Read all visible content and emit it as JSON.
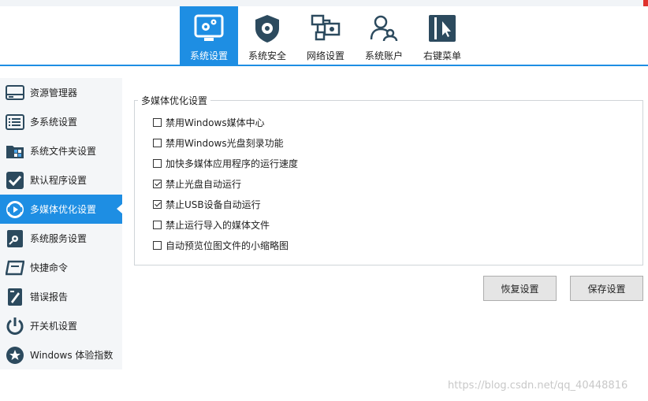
{
  "toolbar": {
    "tabs": [
      {
        "label": "系统设置",
        "icon": "gear-screen-icon",
        "active": true
      },
      {
        "label": "系统安全",
        "icon": "shield-gear-icon",
        "active": false
      },
      {
        "label": "网络设置",
        "icon": "network-icon",
        "active": false
      },
      {
        "label": "系统账户",
        "icon": "users-icon",
        "active": false
      },
      {
        "label": "右键菜单",
        "icon": "context-menu-icon",
        "active": false
      }
    ]
  },
  "sidebar": {
    "items": [
      {
        "label": "资源管理器",
        "icon": "explorer-icon"
      },
      {
        "label": "多系统设置",
        "icon": "multi-system-icon"
      },
      {
        "label": "系统文件夹设置",
        "icon": "windows-folder-icon"
      },
      {
        "label": "默认程序设置",
        "icon": "default-program-icon"
      },
      {
        "label": "多媒体优化设置",
        "icon": "multimedia-icon",
        "active": true
      },
      {
        "label": "系统服务设置",
        "icon": "service-icon"
      },
      {
        "label": "快捷命令",
        "icon": "command-icon"
      },
      {
        "label": "错误报告",
        "icon": "error-report-icon"
      },
      {
        "label": "开关机设置",
        "icon": "power-icon"
      },
      {
        "label": "Windows 体验指数",
        "icon": "star-icon"
      }
    ]
  },
  "main": {
    "group_title": "多媒体优化设置",
    "options": [
      {
        "label": "禁用Windows媒体中心",
        "checked": false
      },
      {
        "label": "禁用Windows光盘刻录功能",
        "checked": false
      },
      {
        "label": "加快多媒体应用程序的运行速度",
        "checked": false
      },
      {
        "label": "禁止光盘自动运行",
        "checked": true
      },
      {
        "label": "禁止USB设备自动运行",
        "checked": true
      },
      {
        "label": "禁止运行导入的媒体文件",
        "checked": false
      },
      {
        "label": "自动预览位图文件的小缩略图",
        "checked": false
      }
    ],
    "restore_label": "恢复设置",
    "save_label": "保存设置"
  },
  "watermark": "https://blog.csdn.net/qq_40448816",
  "colors": {
    "accent": "#1e8ee3",
    "icon_dark": "#2c4a5e"
  }
}
